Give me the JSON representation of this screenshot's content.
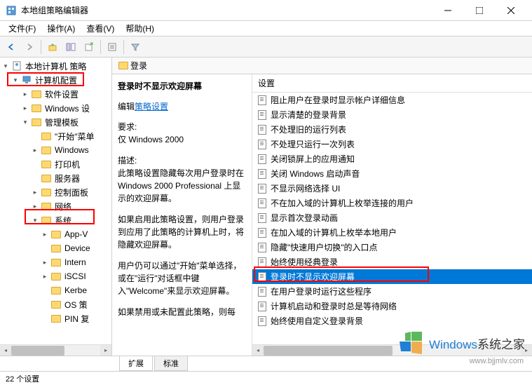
{
  "title": "本地组策略编辑器",
  "menu": {
    "file": "文件(F)",
    "action": "操作(A)",
    "view": "查看(V)",
    "help": "帮助(H)"
  },
  "tree": {
    "root": "本地计算机 策略",
    "items": [
      {
        "label": "计算机配置",
        "indent": 1,
        "chevron": "▾",
        "icon": "computer"
      },
      {
        "label": "软件设置",
        "indent": 2,
        "chevron": "▸",
        "icon": "folder"
      },
      {
        "label": "Windows 设",
        "indent": 2,
        "chevron": "▸",
        "icon": "folder"
      },
      {
        "label": "管理模板",
        "indent": 2,
        "chevron": "▾",
        "icon": "folder"
      },
      {
        "label": "\"开始\"菜单",
        "indent": 3,
        "chevron": "",
        "icon": "folder"
      },
      {
        "label": "Windows",
        "indent": 3,
        "chevron": "▸",
        "icon": "folder"
      },
      {
        "label": "打印机",
        "indent": 3,
        "chevron": "",
        "icon": "folder"
      },
      {
        "label": "服务器",
        "indent": 3,
        "chevron": "",
        "icon": "folder"
      },
      {
        "label": "控制面板",
        "indent": 3,
        "chevron": "▸",
        "icon": "folder"
      },
      {
        "label": "网络",
        "indent": 3,
        "chevron": "▸",
        "icon": "folder"
      },
      {
        "label": "系统",
        "indent": 3,
        "chevron": "▾",
        "icon": "folder"
      },
      {
        "label": "App-V",
        "indent": 4,
        "chevron": "▸",
        "icon": "folder"
      },
      {
        "label": "Device",
        "indent": 4,
        "chevron": "",
        "icon": "folder"
      },
      {
        "label": "Intern",
        "indent": 4,
        "chevron": "▸",
        "icon": "folder"
      },
      {
        "label": "iSCSI",
        "indent": 4,
        "chevron": "▸",
        "icon": "folder"
      },
      {
        "label": "Kerbe",
        "indent": 4,
        "chevron": "",
        "icon": "folder"
      },
      {
        "label": "OS 策",
        "indent": 4,
        "chevron": "",
        "icon": "folder"
      },
      {
        "label": "PIN 复",
        "indent": 4,
        "chevron": "",
        "icon": "folder"
      }
    ]
  },
  "content": {
    "header": "登录",
    "desc": {
      "title": "登录时不显示欢迎屏幕",
      "edit_label": "编辑",
      "edit_link": "策略设置",
      "req_label": "要求:",
      "req_value": "仅 Windows 2000",
      "desc_label": "描述:",
      "desc_text1": "此策略设置隐藏每次用户登录时在 Windows 2000 Professional 上显示的欢迎屏幕。",
      "desc_text2": "如果启用此策略设置，则用户登录到应用了此策略的计算机上时，将隐藏欢迎屏幕。",
      "desc_text3": "用户仍可以通过\"开始\"菜单选择，或在\"运行\"对话框中键入\"Welcome\"来显示欢迎屏幕。",
      "desc_text4": "如果禁用或未配置此策略，则每"
    },
    "settings_header": "设置",
    "settings": [
      "阻止用户在登录时显示帐户详细信息",
      "显示清楚的登录背景",
      "不处理旧的运行列表",
      "不处理只运行一次列表",
      "关闭锁屏上的应用通知",
      "关闭 Windows 启动声音",
      "不显示网络选择 UI",
      "不在加入域的计算机上枚举连接的用户",
      "显示首次登录动画",
      "在加入域的计算机上枚举本地用户",
      "隐藏\"快速用户切换\"的入口点",
      "始终使用经典登录",
      "登录时不显示欢迎屏幕",
      "在用户登录时运行这些程序",
      "计算机启动和登录时总是等待网络",
      "始终使用自定义登录背景"
    ],
    "selected_index": 12
  },
  "tabs": {
    "extended": "扩展",
    "standard": "标准"
  },
  "statusbar": "22 个设置",
  "watermark": {
    "brand": "Windows",
    "suffix": "系统之家",
    "url": "www.bjjmlv.com"
  }
}
